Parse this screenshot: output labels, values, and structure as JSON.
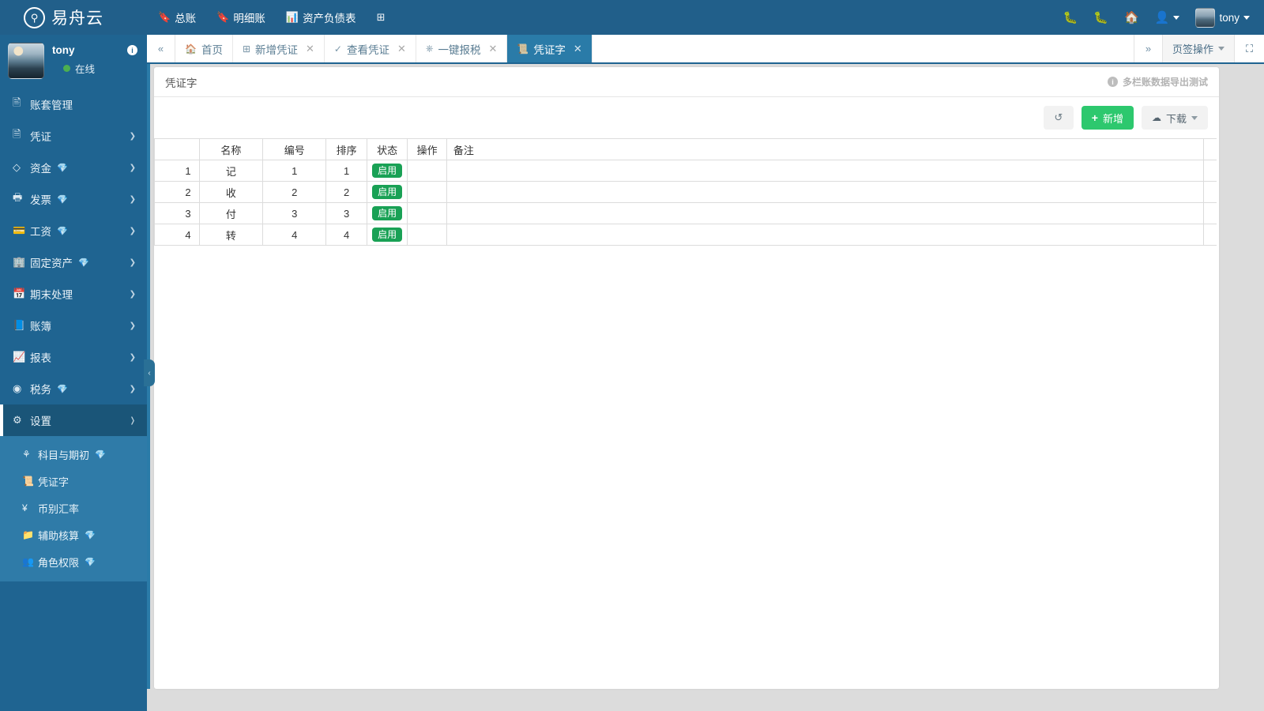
{
  "header": {
    "brand": "易舟云",
    "brand_icon": "tree-logo-icon",
    "nav": [
      {
        "label": "总账",
        "icon": "book-icon"
      },
      {
        "label": "明细账",
        "icon": "book-icon"
      },
      {
        "label": "资产负债表",
        "icon": "chart-icon"
      },
      {
        "label": "",
        "icon": "add-panel-icon"
      }
    ],
    "right": {
      "bug_icon_1": "bug-icon",
      "bug_icon_2": "bug-icon",
      "home_icon": "home-icon",
      "user_icon": "user-icon",
      "username": "tony"
    }
  },
  "sidebar": {
    "profile": {
      "name": "tony",
      "badge": "i",
      "status": "在线"
    },
    "items": [
      {
        "label": "账套管理",
        "icon": "account-set-icon",
        "gem": false,
        "arrow": false,
        "active": false
      },
      {
        "label": "凭证",
        "icon": "voucher-icon",
        "gem": false,
        "arrow": true,
        "active": false
      },
      {
        "label": "资金",
        "icon": "funds-icon",
        "gem": true,
        "arrow": true,
        "active": false
      },
      {
        "label": "发票",
        "icon": "invoice-icon",
        "gem": true,
        "arrow": true,
        "active": false
      },
      {
        "label": "工资",
        "icon": "salary-icon",
        "gem": true,
        "arrow": true,
        "active": false
      },
      {
        "label": "固定资产",
        "icon": "fixed-asset-icon",
        "gem": true,
        "arrow": true,
        "active": false
      },
      {
        "label": "期末处理",
        "icon": "period-end-icon",
        "gem": false,
        "arrow": true,
        "active": false
      },
      {
        "label": "账簿",
        "icon": "ledger-icon",
        "gem": false,
        "arrow": true,
        "active": false
      },
      {
        "label": "报表",
        "icon": "report-icon",
        "gem": false,
        "arrow": true,
        "active": false
      },
      {
        "label": "税务",
        "icon": "tax-icon",
        "gem": true,
        "arrow": true,
        "active": false
      },
      {
        "label": "设置",
        "icon": "gear-icon",
        "gem": false,
        "arrow": true,
        "active": true
      }
    ],
    "submenu": [
      {
        "label": "科目与期初",
        "icon": "subject-icon",
        "gem": true
      },
      {
        "label": "凭证字",
        "icon": "voucher-word-icon",
        "gem": false
      },
      {
        "label": "币别汇率",
        "icon": "currency-icon",
        "gem": false
      },
      {
        "label": "辅助核算",
        "icon": "folder-icon",
        "gem": true
      },
      {
        "label": "角色权限",
        "icon": "users-icon",
        "gem": true
      }
    ],
    "collapse_handle": "‹"
  },
  "tabbar": {
    "prev_icon": "double-chevron-left-icon",
    "next_icon": "double-chevron-right-icon",
    "tabs": [
      {
        "label": "首页",
        "icon": "home-icon",
        "closable": false,
        "active": false
      },
      {
        "label": "新增凭证",
        "icon": "add-box-icon",
        "closable": true,
        "active": false
      },
      {
        "label": "查看凭证",
        "icon": "check-circle-icon",
        "closable": true,
        "active": false
      },
      {
        "label": "一键报税",
        "icon": "power-icon",
        "closable": true,
        "active": false
      },
      {
        "label": "凭证字",
        "icon": "voucher-word-icon",
        "closable": true,
        "active": true
      }
    ],
    "operations_label": "页签操作",
    "fullscreen_icon": "fullscreen-icon"
  },
  "panel": {
    "title": "凭证字",
    "note": "多栏账数据导出测试",
    "toolbar": {
      "refresh_icon": "refresh-icon",
      "add_label": "新增",
      "download_label": "下载"
    },
    "table": {
      "columns": [
        "",
        "名称",
        "编号",
        "排序",
        "状态",
        "操作",
        "备注"
      ],
      "rows": [
        {
          "index": "1",
          "name": "记",
          "number": "1",
          "sort": "1",
          "state": "启用",
          "operation": "",
          "remark": ""
        },
        {
          "index": "2",
          "name": "收",
          "number": "2",
          "sort": "2",
          "state": "启用",
          "operation": "",
          "remark": ""
        },
        {
          "index": "3",
          "name": "付",
          "number": "3",
          "sort": "3",
          "state": "启用",
          "operation": "",
          "remark": ""
        },
        {
          "index": "4",
          "name": "转",
          "number": "4",
          "sort": "4",
          "state": "启用",
          "operation": "",
          "remark": ""
        }
      ]
    }
  },
  "colors": {
    "header_blue": "#215f8a",
    "sidebar_blue": "#1f6491",
    "submenu_blue": "#2f7ba8",
    "accent_green": "#2dc86e",
    "badge_green": "#19a155",
    "active_tab": "#2a7ba8"
  }
}
